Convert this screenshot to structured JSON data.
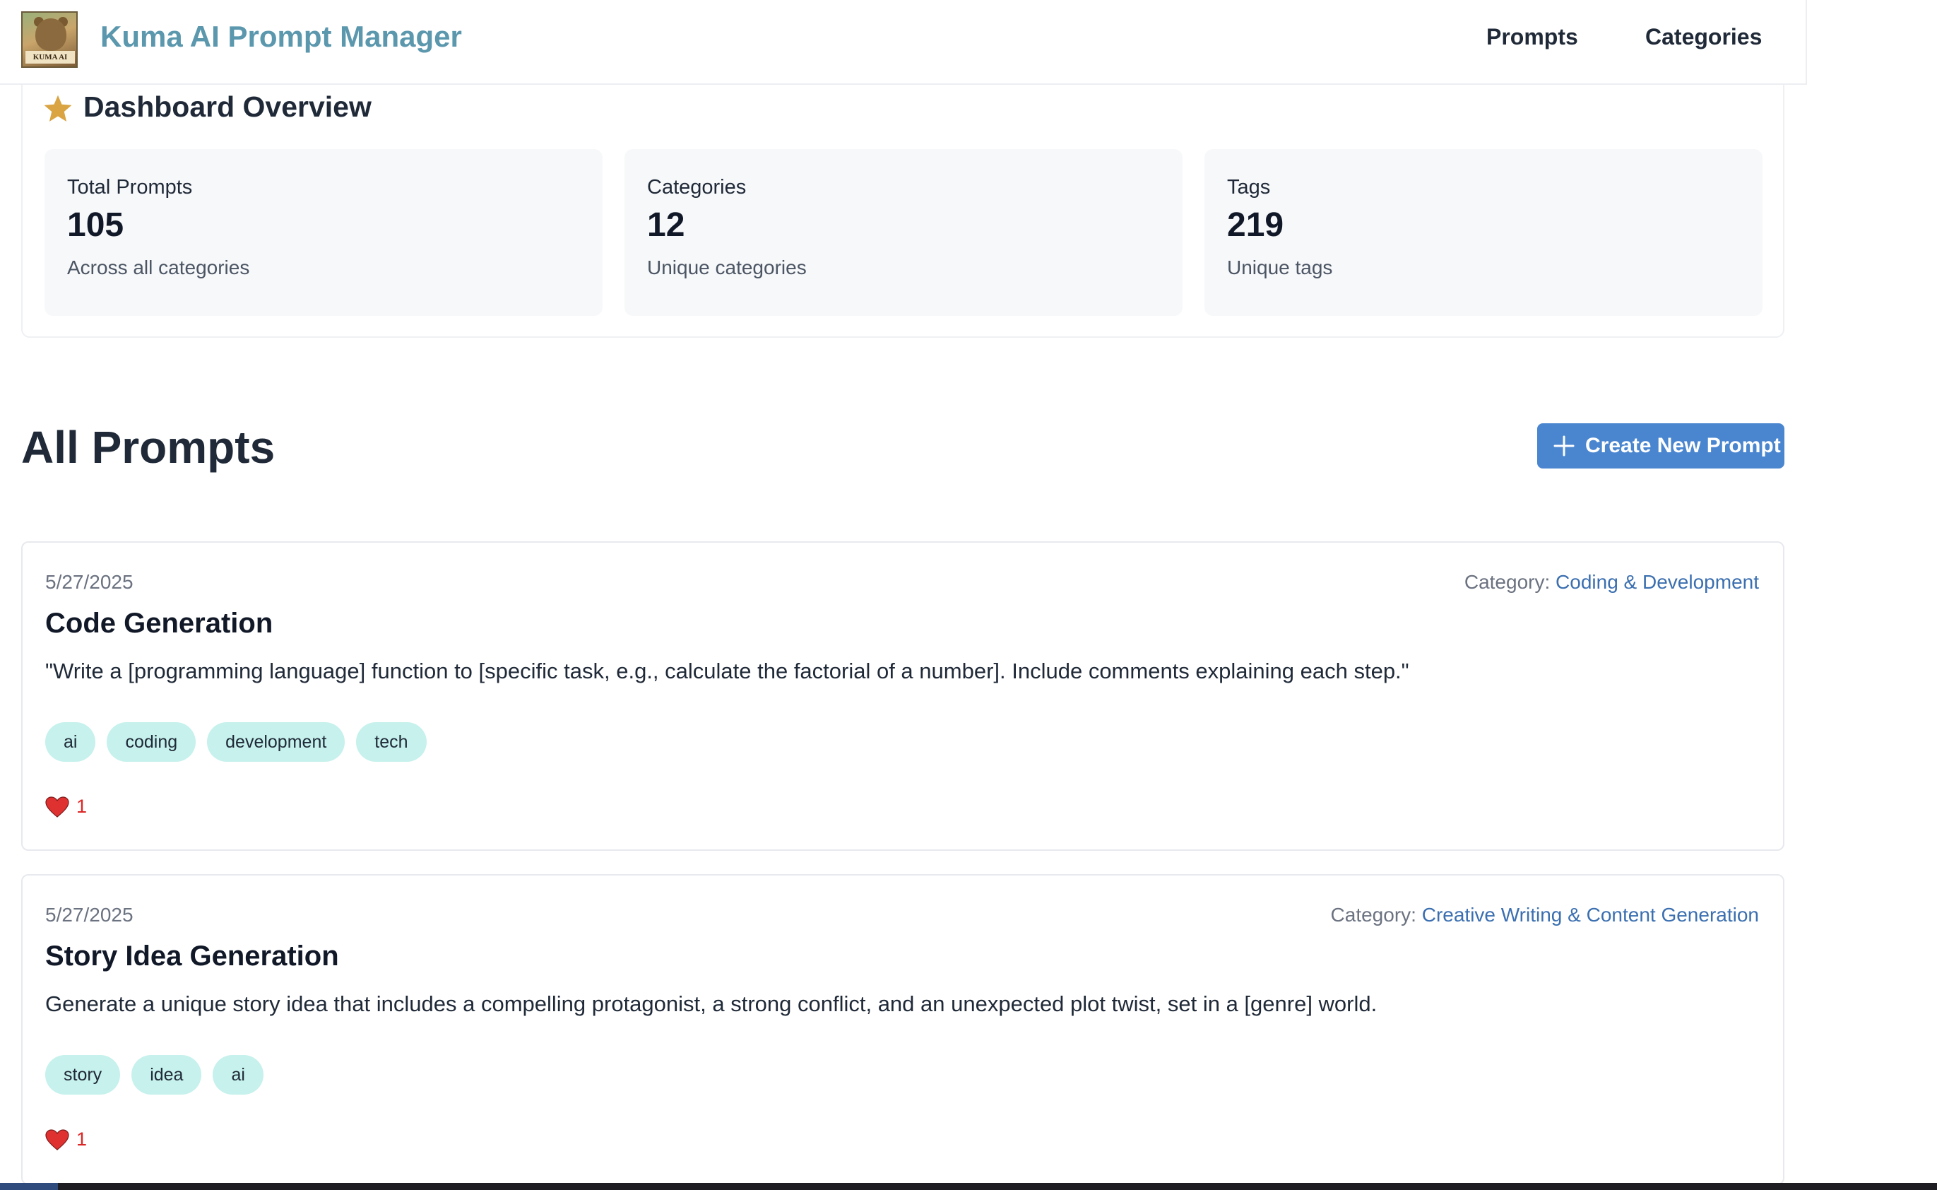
{
  "app": {
    "logo_text": "KUMA AI",
    "title": "Kuma AI Prompt Manager"
  },
  "nav": {
    "prompts": "Prompts",
    "categories": "Categories"
  },
  "overview": {
    "title": "Dashboard Overview",
    "icon": "star-icon",
    "accent_color": "#d9a441",
    "stats": [
      {
        "label": "Total Prompts",
        "value": "105",
        "sub": "Across all categories"
      },
      {
        "label": "Categories",
        "value": "12",
        "sub": "Unique categories"
      },
      {
        "label": "Tags",
        "value": "219",
        "sub": "Unique tags"
      }
    ]
  },
  "prompts_section": {
    "title": "All Prompts",
    "create_button": "Create New Prompt",
    "button_color": "#4a86cf"
  },
  "prompts": [
    {
      "date": "5/27/2025",
      "category_label": "Category:",
      "category": "Coding & Development",
      "title": "Code Generation",
      "description": "\"Write a [programming language] function to [specific task, e.g., calculate the factorial of a number]. Include comments explaining each step.\"",
      "tags": [
        "ai",
        "coding",
        "development",
        "tech"
      ],
      "likes": "1"
    },
    {
      "date": "5/27/2025",
      "category_label": "Category:",
      "category": "Creative Writing & Content Generation",
      "title": "Story Idea Generation",
      "description": "Generate a unique story idea that includes a compelling protagonist, a strong conflict, and an unexpected plot twist, set in a [genre] world.",
      "tags": [
        "story",
        "idea",
        "ai"
      ],
      "likes": "1"
    }
  ],
  "colors": {
    "brand": "#5b97ad",
    "tag_bg": "#c6f1ec",
    "link": "#3b6fb0",
    "like": "#dc2626"
  }
}
